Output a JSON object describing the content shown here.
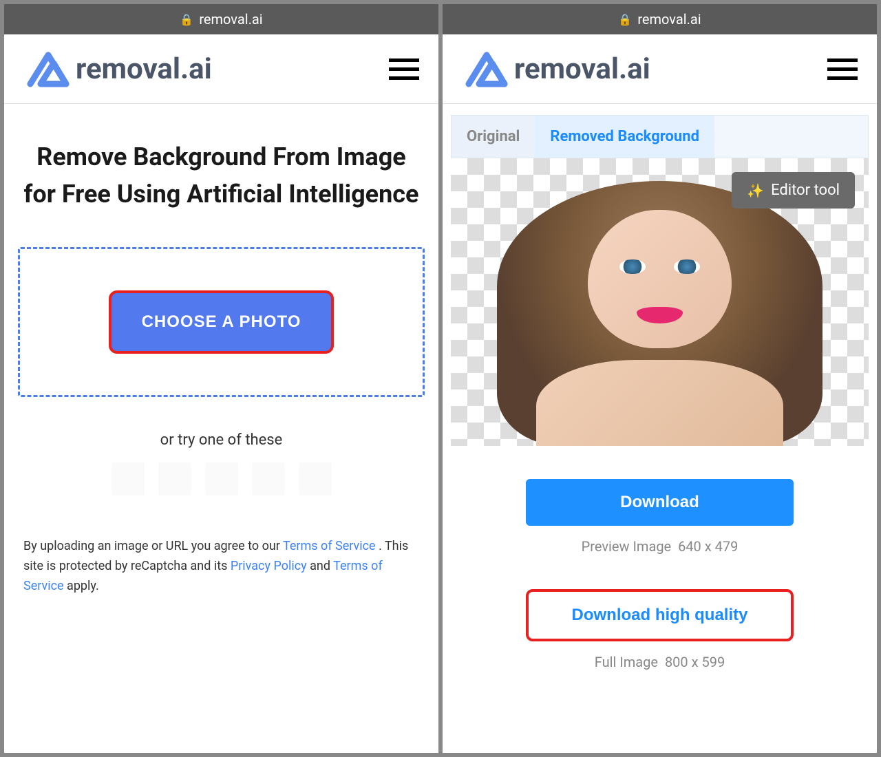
{
  "url": "removal.ai",
  "brand": "removal.ai",
  "left": {
    "heading": "Remove Background From Image for Free Using Artificial Intelligence",
    "choose_button": "CHOOSE A PHOTO",
    "try_text": "or try one of these",
    "footer": {
      "part1": "By uploading an image or URL you agree to our ",
      "tos1": "Terms of Service",
      "part2": " . This site is protected by reCaptcha and its ",
      "privacy": "Privacy Policy",
      "part3": " and ",
      "tos2": "Terms of Service",
      "part4": " apply."
    }
  },
  "right": {
    "tabs": {
      "original": "Original",
      "removed": "Removed Background"
    },
    "editor_tool": "Editor tool",
    "download": "Download",
    "preview_label": "Preview Image",
    "preview_dim": "640 x 479",
    "download_hq": "Download high quality",
    "full_label": "Full Image",
    "full_dim": "800 x 599"
  }
}
